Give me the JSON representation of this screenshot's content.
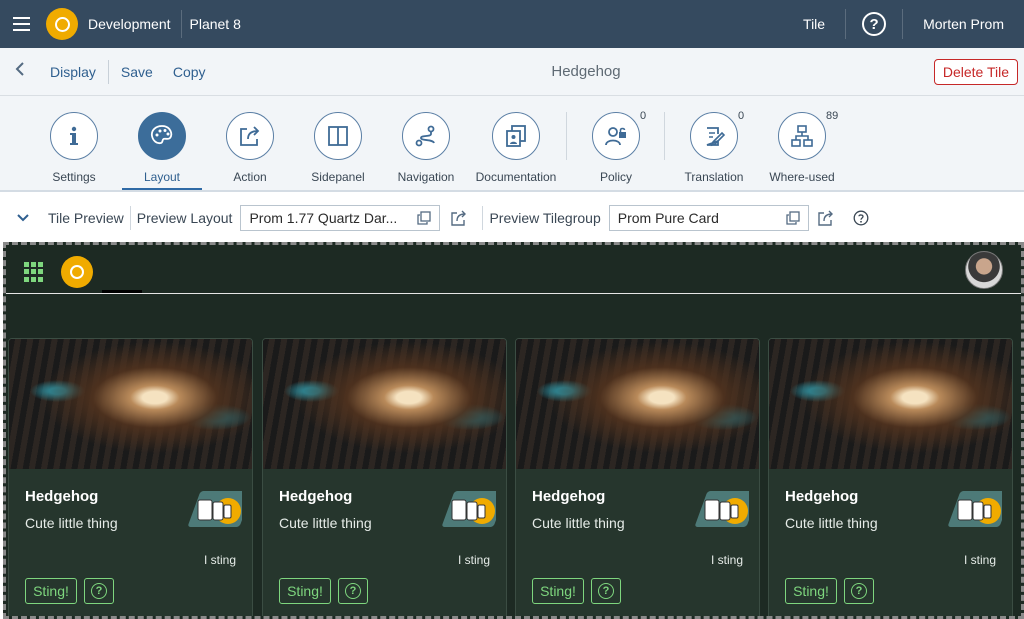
{
  "shell": {
    "title": "Development",
    "subtitle": "Planet 8",
    "tile_link": "Tile",
    "help_icon": "help-icon",
    "user": "Morten Prom"
  },
  "toolbar": {
    "display": "Display",
    "save": "Save",
    "copy": "Copy",
    "title": "Hedgehog",
    "delete": "Delete Tile"
  },
  "tabs": [
    {
      "label": "Settings",
      "icon": "info-icon",
      "count": ""
    },
    {
      "label": "Layout",
      "icon": "palette-icon",
      "count": "",
      "active": true
    },
    {
      "label": "Action",
      "icon": "share-icon",
      "count": ""
    },
    {
      "label": "Sidepanel",
      "icon": "sidepanel-icon",
      "count": ""
    },
    {
      "label": "Navigation",
      "icon": "route-icon",
      "count": ""
    },
    {
      "label": "Documentation",
      "icon": "documents-icon",
      "count": ""
    },
    {
      "label": "Policy",
      "icon": "user-lock-icon",
      "count": "0"
    },
    {
      "label": "Translation",
      "icon": "edit-document-icon",
      "count": "0"
    },
    {
      "label": "Where-used",
      "icon": "hierarchy-icon",
      "count": "89"
    }
  ],
  "preview_bar": {
    "tile_preview": "Tile Preview",
    "preview_layout_label": "Preview Layout",
    "preview_layout_value": "Prom 1.77 Quartz Dar...",
    "preview_tilegroup_label": "Preview Tilegroup",
    "preview_tilegroup_value": "Prom Pure Card"
  },
  "cards": [
    {
      "title": "Hedgehog",
      "subtitle": "Cute little thing",
      "note": "I sting",
      "button": "Sting!"
    },
    {
      "title": "Hedgehog",
      "subtitle": "Cute little thing",
      "note": "I sting",
      "button": "Sting!"
    },
    {
      "title": "Hedgehog",
      "subtitle": "Cute little thing",
      "note": "I sting",
      "button": "Sting!"
    },
    {
      "title": "Hedgehog",
      "subtitle": "Cute little thing",
      "note": "I sting",
      "button": "Sting!"
    }
  ],
  "colors": {
    "shell": "#354a5f",
    "accent": "#f0ab00",
    "preview_bg": "#1d2a23",
    "card_accent": "#7ed67e",
    "danger": "#c62828"
  }
}
